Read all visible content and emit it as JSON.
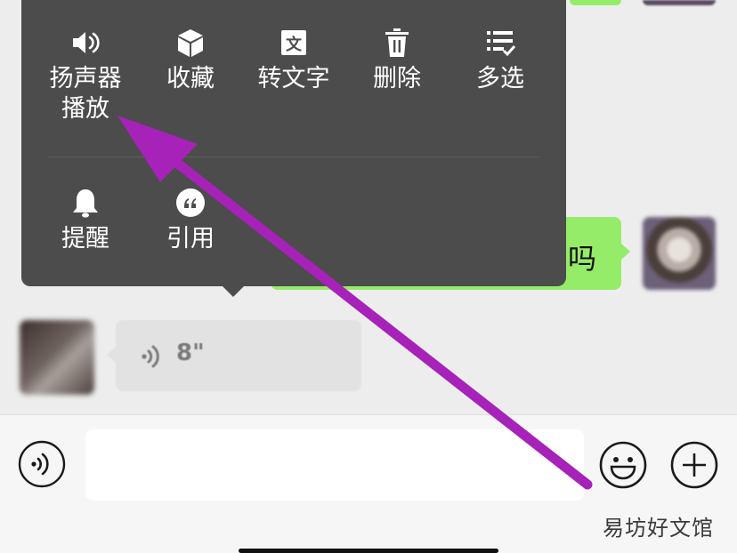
{
  "chat": {
    "green_bubble_text": "吗",
    "voice_message_duration": "8\""
  },
  "context_menu": {
    "row1": [
      {
        "label": "扬声器\n播放",
        "icon": "speaker-icon"
      },
      {
        "label": "收藏",
        "icon": "cube-icon"
      },
      {
        "label": "转文字",
        "icon": "text-convert-icon"
      },
      {
        "label": "删除",
        "icon": "trash-icon"
      },
      {
        "label": "多选",
        "icon": "multi-select-icon"
      }
    ],
    "row2": [
      {
        "label": "提醒",
        "icon": "bell-icon"
      },
      {
        "label": "引用",
        "icon": "quote-icon"
      }
    ]
  },
  "input_bar": {
    "voice_toggle_icon": "voice-mode-icon",
    "emoji_icon": "emoji-icon",
    "plus_icon": "plus-icon"
  },
  "watermark": "易坊好文馆",
  "colors": {
    "menu_bg": "#4c4c4c",
    "green_bubble": "#95ec69",
    "annotation_arrow": "#a622b8"
  }
}
